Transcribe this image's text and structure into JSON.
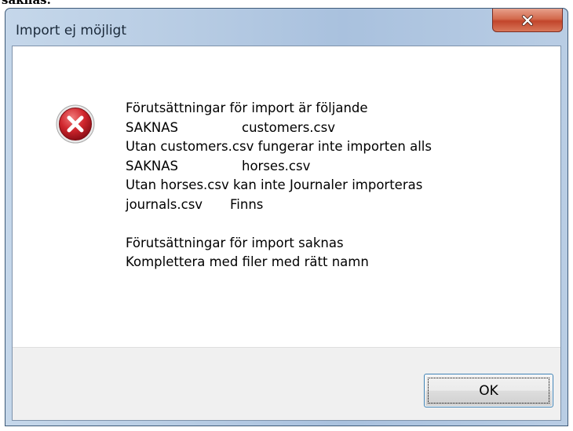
{
  "window": {
    "title": "Import ej möjligt",
    "close_label": "x"
  },
  "message": {
    "icon": "error-icon",
    "line1": "Förutsättningar för import är följande",
    "line2_label": "SAKNAS",
    "line2_value": "customers.csv",
    "line3": "Utan customers.csv fungerar inte importen alls",
    "line4_label": "SAKNAS",
    "line4_value": "horses.csv",
    "line5": "Utan horses.csv kan inte Journaler importeras",
    "line6_label": "journals.csv",
    "line6_value": "Finns",
    "line8": "Förutsättningar för import saknas",
    "line9": "Komplettera med filer med rätt namn"
  },
  "buttons": {
    "ok_label": "OK"
  },
  "colors": {
    "close_button": "#c2452b",
    "error_icon": "#c8202a",
    "title_bar": "#b6cbe3"
  }
}
